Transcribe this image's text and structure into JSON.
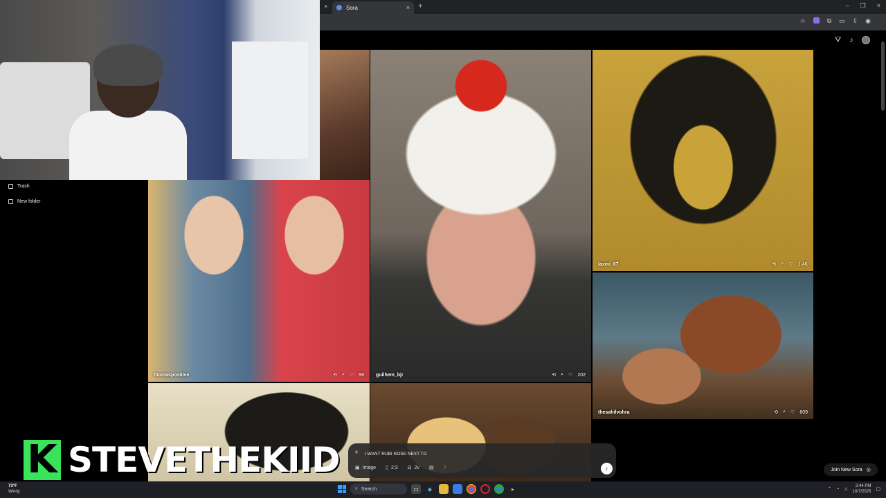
{
  "browser": {
    "tab_title": "Sora",
    "tab_close": "×",
    "new_tab": "+",
    "prev_tab_close": "×",
    "window_controls": [
      "–",
      "❐",
      "×"
    ]
  },
  "sidebar": {
    "items": [
      {
        "label": "Trash",
        "icon": "trash-icon"
      },
      {
        "label": "New folder",
        "icon": "folder-icon"
      }
    ]
  },
  "feed": {
    "tiles": [
      {
        "user": "thomaspositive",
        "likes": "98"
      },
      {
        "user": "guilhem_bjr",
        "likes": "202"
      },
      {
        "user": "laxmi_07",
        "likes": "1.4K"
      },
      {
        "user": "thesahilvohra",
        "likes": "609"
      }
    ]
  },
  "composer": {
    "plus": "+",
    "value": "I WANT RUBI ROSE NEXT TO",
    "type_label": "Image",
    "aspect": "2:3",
    "variations": "2v",
    "help": "?",
    "send": "↑"
  },
  "join_button": "Join New Sora",
  "banner": {
    "logo_letter": "K",
    "name": "STEVETHEKIID"
  },
  "taskbar": {
    "weather_temp": "73°F",
    "weather_desc": "Windy",
    "search_placeholder": "Search",
    "time": "2:44 PM",
    "date": "10/7/2025"
  },
  "colors": {
    "accent_green": "#39e35a",
    "windows_blue": "#3aa0ff",
    "chrome_dark": "#202124"
  }
}
